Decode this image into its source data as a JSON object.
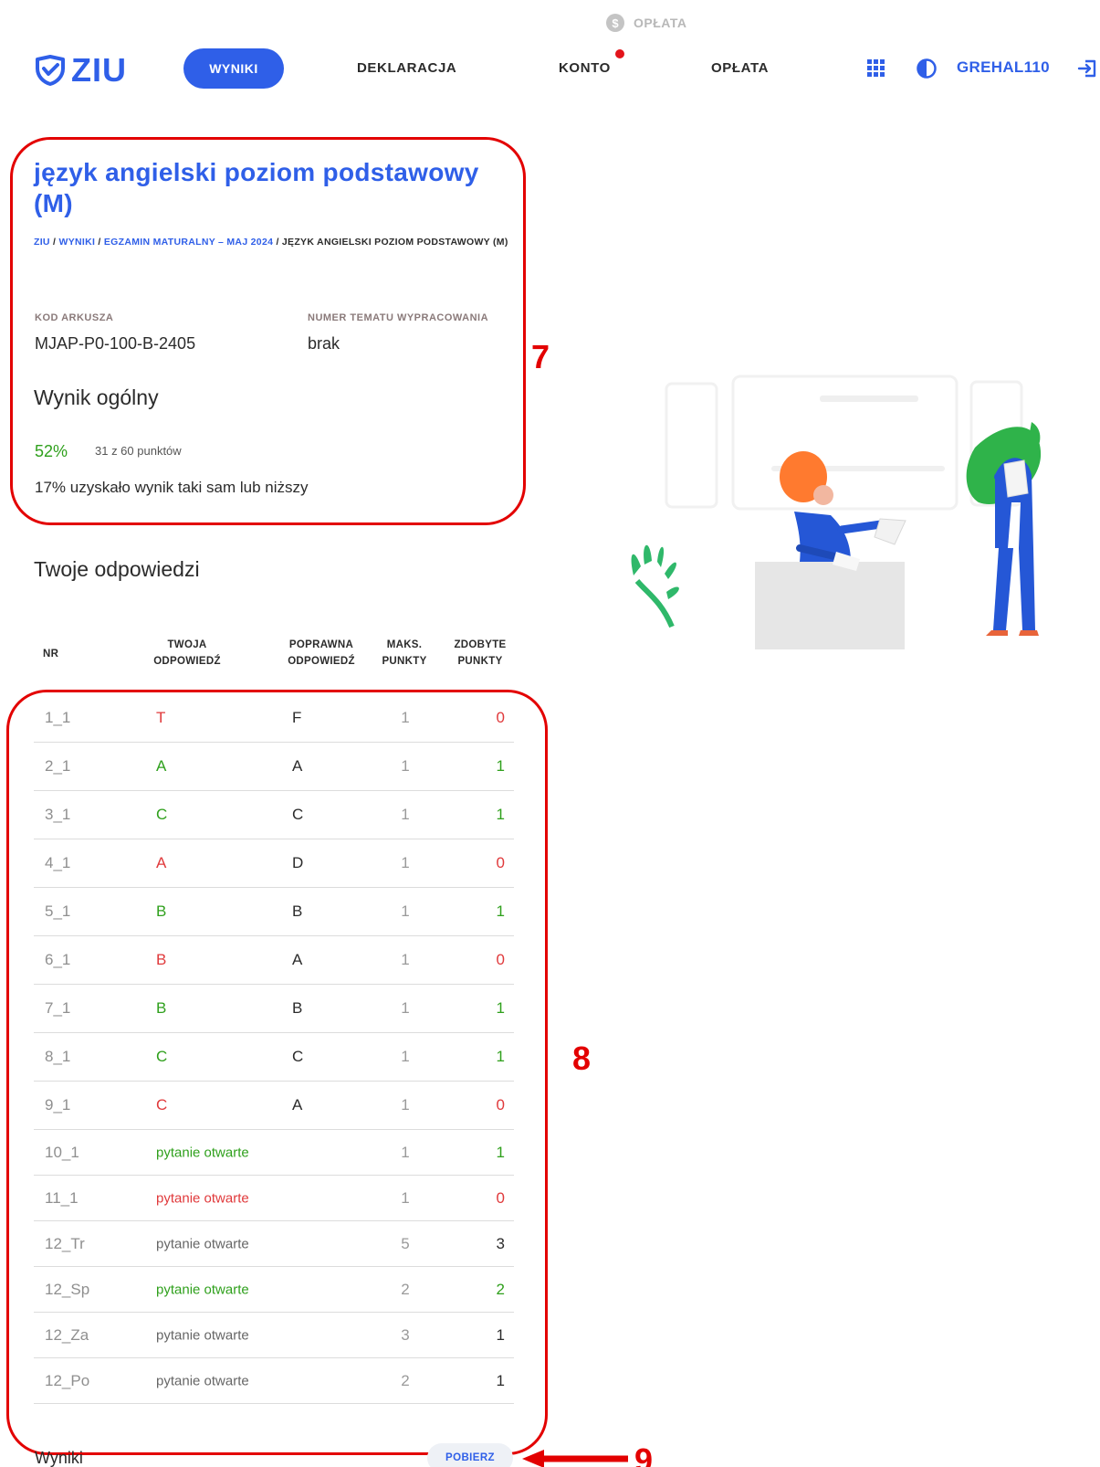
{
  "top_hint": {
    "icon": "dollar-coin-icon",
    "label": "OPŁATA"
  },
  "logo": {
    "text": "ZIU",
    "icon": "shield-check-icon"
  },
  "nav": {
    "items": [
      {
        "label": "WYNIKI",
        "active": true
      },
      {
        "label": "DEKLARACJA",
        "active": false
      },
      {
        "label": "KONTO",
        "active": false,
        "notification": true
      },
      {
        "label": "OPŁATA",
        "active": false
      }
    ]
  },
  "user": {
    "name": "GREHAL110"
  },
  "icons": {
    "apps": "apps-grid-icon",
    "contrast": "contrast-icon",
    "logout": "logout-icon"
  },
  "exam": {
    "title": "język angielski poziom podstawowy (M)",
    "breadcrumb": [
      {
        "label": "ZIU",
        "link": true
      },
      {
        "label": "WYNIKI",
        "link": true
      },
      {
        "label": "EGZAMIN MATURALNY – MAJ 2024",
        "link": true
      },
      {
        "label": "JĘZYK ANGIELSKI POZIOM PODSTAWOWY (M)",
        "link": false
      }
    ],
    "sheet_code_label": "KOD ARKUSZA",
    "sheet_code": "MJAP-P0-100-B-2405",
    "topic_label": "NUMER TEMATU WYPRACOWANIA",
    "topic": "brak",
    "overall_heading": "Wynik ogólny",
    "overall_percent": "52%",
    "overall_points": "31 z 60 punktów",
    "percentile": "17% uzyskało wynik taki sam lub niższy"
  },
  "answers": {
    "heading": "Twoje odpowiedzi",
    "columns": {
      "nr": "NR",
      "your_1": "TWOJA",
      "your_2": "ODPOWIEDŹ",
      "correct_1": "POPRAWNA",
      "correct_2": "ODPOWIEDŹ",
      "max_1": "MAKS.",
      "max_2": "PUNKTY",
      "got_1": "ZDOBYTE",
      "got_2": "PUNKTY"
    },
    "rows": [
      {
        "nr": "1_1",
        "your": "T",
        "correct": "F",
        "max": "1",
        "got": "0",
        "status": "wrong"
      },
      {
        "nr": "2_1",
        "your": "A",
        "correct": "A",
        "max": "1",
        "got": "1",
        "status": "correct"
      },
      {
        "nr": "3_1",
        "your": "C",
        "correct": "C",
        "max": "1",
        "got": "1",
        "status": "correct"
      },
      {
        "nr": "4_1",
        "your": "A",
        "correct": "D",
        "max": "1",
        "got": "0",
        "status": "wrong"
      },
      {
        "nr": "5_1",
        "your": "B",
        "correct": "B",
        "max": "1",
        "got": "1",
        "status": "correct"
      },
      {
        "nr": "6_1",
        "your": "B",
        "correct": "A",
        "max": "1",
        "got": "0",
        "status": "wrong"
      },
      {
        "nr": "7_1",
        "your": "B",
        "correct": "B",
        "max": "1",
        "got": "1",
        "status": "correct"
      },
      {
        "nr": "8_1",
        "your": "C",
        "correct": "C",
        "max": "1",
        "got": "1",
        "status": "correct"
      },
      {
        "nr": "9_1",
        "your": "C",
        "correct": "A",
        "max": "1",
        "got": "0",
        "status": "wrong"
      },
      {
        "nr": "10_1",
        "your": "pytanie otwarte",
        "correct": "",
        "max": "1",
        "got": "1",
        "status": "correct"
      },
      {
        "nr": "11_1",
        "your": "pytanie otwarte",
        "correct": "",
        "max": "1",
        "got": "0",
        "status": "wrong"
      },
      {
        "nr": "12_Tr",
        "your": "pytanie otwarte",
        "correct": "",
        "max": "5",
        "got": "3",
        "status": "partial"
      },
      {
        "nr": "12_Sp",
        "your": "pytanie otwarte",
        "correct": "",
        "max": "2",
        "got": "2",
        "status": "correct"
      },
      {
        "nr": "12_Za",
        "your": "pytanie otwarte",
        "correct": "",
        "max": "3",
        "got": "1",
        "status": "partial"
      },
      {
        "nr": "12_Po",
        "your": "pytanie otwarte",
        "correct": "",
        "max": "2",
        "got": "1",
        "status": "partial"
      }
    ]
  },
  "footer": {
    "label": "Wyniki",
    "download_label": "POBIERZ"
  },
  "annotations": {
    "box_7": "7",
    "box_8": "8",
    "box_9": "9"
  },
  "colors": {
    "accent": "#2f5fe8",
    "correct": "#2fa01c",
    "wrong": "#e0393b",
    "annotation": "#e30000"
  }
}
